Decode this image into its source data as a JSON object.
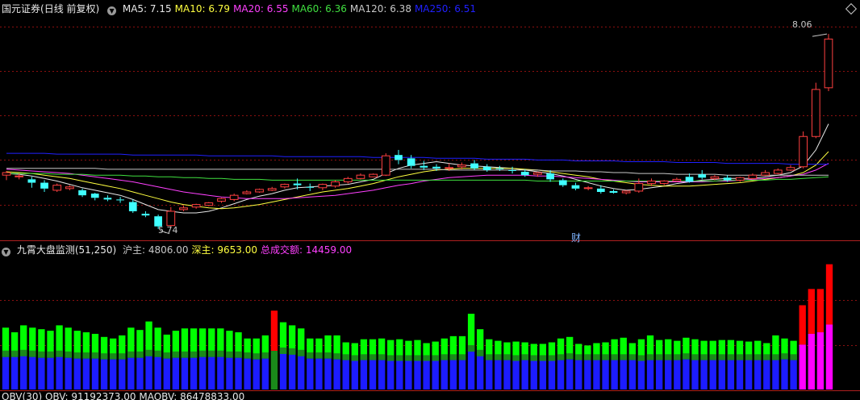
{
  "main_header": {
    "stock_name": "国元证券",
    "period_label": "(日线 前复权)",
    "toggle_icon": "chevron-down-icon",
    "ma_items": [
      {
        "label": "MA5: 7.15",
        "color": "#e8e8e8"
      },
      {
        "label": "MA10: 6.79",
        "color": "#ffff40"
      },
      {
        "label": "MA20: 6.55",
        "color": "#ff40ff"
      },
      {
        "label": "MA60: 6.36",
        "color": "#40e040"
      },
      {
        "label": "MA120: 6.38",
        "color": "#c8c8c8"
      },
      {
        "label": "MA250: 6.51",
        "color": "#2020ff"
      }
    ]
  },
  "price_labels": {
    "high": "8.06",
    "low": "5.74"
  },
  "event_marker": "财",
  "indicator_header": {
    "name": "九霄大盘监测(51,250)",
    "items": [
      {
        "label": "沪主: 4806.00",
        "color": "#c8c8c8"
      },
      {
        "label": "深主: 9653.00",
        "color": "#ffff40"
      },
      {
        "label": "总成交额: 14459.00",
        "color": "#ff40ff"
      }
    ]
  },
  "bottom_header": {
    "text": "OBV(30)  OBV: 91192373.00  MAOBV: 86478833.00"
  },
  "colors": {
    "up": "#ff4040",
    "down": "#40ffff",
    "grid": "#8b1010",
    "bar_green": "#00ff00",
    "bar_blue": "#1c1cff",
    "bar_red": "#ff0000",
    "bar_magenta": "#ff00ff",
    "bar_darkgreen": "#1a8a1a"
  },
  "chart_data": {
    "type": "candlestick",
    "candles": [
      [
        6.38,
        6.43,
        6.41,
        6.32
      ],
      [
        6.36,
        6.4,
        6.37,
        6.33
      ],
      [
        6.33,
        6.36,
        6.29,
        6.23
      ],
      [
        6.29,
        6.32,
        6.22,
        6.18
      ],
      [
        6.2,
        6.28,
        6.26,
        6.18
      ],
      [
        6.22,
        6.26,
        6.24,
        6.2
      ],
      [
        6.2,
        6.22,
        6.14,
        6.12
      ],
      [
        6.16,
        6.17,
        6.11,
        6.08
      ],
      [
        6.11,
        6.14,
        6.09,
        6.07
      ],
      [
        6.09,
        6.12,
        6.08,
        6.05
      ],
      [
        6.06,
        6.09,
        5.95,
        5.93
      ],
      [
        5.92,
        5.95,
        5.9,
        5.88
      ],
      [
        5.89,
        5.91,
        5.77,
        5.74
      ],
      [
        5.78,
        6.0,
        5.95,
        5.76
      ],
      [
        5.97,
        6.02,
        5.99,
        5.95
      ],
      [
        6.0,
        6.04,
        6.03,
        5.98
      ],
      [
        6.02,
        6.06,
        6.05,
        6.01
      ],
      [
        6.07,
        6.11,
        6.1,
        6.05
      ],
      [
        6.09,
        6.16,
        6.14,
        6.07
      ],
      [
        6.16,
        6.2,
        6.18,
        6.15
      ],
      [
        6.18,
        6.22,
        6.21,
        6.17
      ],
      [
        6.2,
        6.24,
        6.22,
        6.19
      ],
      [
        6.24,
        6.28,
        6.27,
        6.22
      ],
      [
        6.28,
        6.34,
        6.26,
        6.21
      ],
      [
        6.24,
        6.28,
        6.23,
        6.19
      ],
      [
        6.23,
        6.28,
        6.27,
        6.2
      ],
      [
        6.25,
        6.32,
        6.3,
        6.23
      ],
      [
        6.3,
        6.36,
        6.34,
        6.28
      ],
      [
        6.34,
        6.4,
        6.38,
        6.33
      ],
      [
        6.36,
        6.4,
        6.39,
        6.36
      ],
      [
        6.38,
        6.64,
        6.61,
        6.37
      ],
      [
        6.62,
        6.68,
        6.56,
        6.51
      ],
      [
        6.58,
        6.62,
        6.49,
        6.46
      ],
      [
        6.49,
        6.55,
        6.47,
        6.44
      ],
      [
        6.48,
        6.51,
        6.46,
        6.43
      ],
      [
        6.46,
        6.52,
        6.47,
        6.43
      ],
      [
        6.48,
        6.53,
        6.5,
        6.45
      ],
      [
        6.52,
        6.56,
        6.46,
        6.44
      ],
      [
        6.48,
        6.51,
        6.44,
        6.42
      ],
      [
        6.46,
        6.49,
        6.45,
        6.43
      ],
      [
        6.44,
        6.48,
        6.43,
        6.4
      ],
      [
        6.42,
        6.45,
        6.38,
        6.36
      ],
      [
        6.39,
        6.42,
        6.41,
        6.36
      ],
      [
        6.4,
        6.44,
        6.33,
        6.3
      ],
      [
        6.32,
        6.34,
        6.26,
        6.24
      ],
      [
        6.26,
        6.29,
        6.22,
        6.2
      ],
      [
        6.22,
        6.25,
        6.23,
        6.2
      ],
      [
        6.22,
        6.26,
        6.18,
        6.16
      ],
      [
        6.19,
        6.21,
        6.17,
        6.16
      ],
      [
        6.17,
        6.2,
        6.19,
        6.15
      ],
      [
        6.19,
        6.34,
        6.28,
        6.17
      ],
      [
        6.28,
        6.34,
        6.31,
        6.25
      ],
      [
        6.28,
        6.32,
        6.31,
        6.26
      ],
      [
        6.31,
        6.35,
        6.33,
        6.3
      ],
      [
        6.36,
        6.4,
        6.3,
        6.29
      ],
      [
        6.39,
        6.44,
        6.35,
        6.33
      ],
      [
        6.34,
        6.38,
        6.36,
        6.32
      ],
      [
        6.35,
        6.38,
        6.32,
        6.3
      ],
      [
        6.32,
        6.36,
        6.35,
        6.3
      ],
      [
        6.34,
        6.4,
        6.38,
        6.33
      ],
      [
        6.38,
        6.44,
        6.41,
        6.37
      ],
      [
        6.4,
        6.46,
        6.44,
        6.39
      ],
      [
        6.44,
        6.5,
        6.47,
        6.43
      ],
      [
        6.48,
        6.9,
        6.84,
        6.46
      ],
      [
        6.84,
        7.48,
        7.4,
        6.82
      ],
      [
        7.42,
        8.06,
        8.0,
        7.38
      ]
    ],
    "ma_series": [
      {
        "name": "MA5",
        "values": [
          6.4,
          6.39,
          6.37,
          6.34,
          6.31,
          6.27,
          6.23,
          6.2,
          6.17,
          6.14,
          6.09,
          6.03,
          5.97,
          5.95,
          5.93,
          5.93,
          5.95,
          5.99,
          6.04,
          6.09,
          6.13,
          6.16,
          6.2,
          6.23,
          6.24,
          6.25,
          6.26,
          6.27,
          6.3,
          6.33,
          6.4,
          6.46,
          6.5,
          6.52,
          6.54,
          6.52,
          6.5,
          6.49,
          6.48,
          6.47,
          6.46,
          6.44,
          6.42,
          6.4,
          6.37,
          6.33,
          6.29,
          6.25,
          6.22,
          6.2,
          6.21,
          6.23,
          6.25,
          6.28,
          6.3,
          6.32,
          6.33,
          6.34,
          6.34,
          6.34,
          6.36,
          6.38,
          6.41,
          6.49,
          6.68,
          6.99
        ]
      },
      {
        "name": "MA10",
        "values": [
          6.42,
          6.41,
          6.4,
          6.38,
          6.36,
          6.34,
          6.31,
          6.28,
          6.25,
          6.22,
          6.18,
          6.14,
          6.1,
          6.06,
          6.03,
          6.01,
          5.99,
          5.98,
          5.99,
          6.01,
          6.03,
          6.06,
          6.09,
          6.12,
          6.15,
          6.18,
          6.2,
          6.22,
          6.25,
          6.28,
          6.32,
          6.36,
          6.39,
          6.42,
          6.44,
          6.45,
          6.46,
          6.46,
          6.46,
          6.46,
          6.46,
          6.45,
          6.44,
          6.42,
          6.4,
          6.38,
          6.36,
          6.33,
          6.31,
          6.29,
          6.27,
          6.26,
          6.25,
          6.25,
          6.25,
          6.26,
          6.27,
          6.28,
          6.29,
          6.31,
          6.33,
          6.35,
          6.37,
          6.41,
          6.5,
          6.66
        ]
      },
      {
        "name": "MA20",
        "values": [
          6.45,
          6.44,
          6.43,
          6.42,
          6.41,
          6.4,
          6.38,
          6.36,
          6.34,
          6.32,
          6.3,
          6.27,
          6.24,
          6.21,
          6.18,
          6.16,
          6.14,
          6.12,
          6.11,
          6.1,
          6.1,
          6.1,
          6.1,
          6.11,
          6.12,
          6.13,
          6.14,
          6.16,
          6.18,
          6.2,
          6.23,
          6.26,
          6.28,
          6.31,
          6.33,
          6.35,
          6.36,
          6.37,
          6.38,
          6.38,
          6.38,
          6.38,
          6.37,
          6.37,
          6.36,
          6.35,
          6.34,
          6.33,
          6.32,
          6.31,
          6.3,
          6.3,
          6.3,
          6.3,
          6.3,
          6.3,
          6.31,
          6.31,
          6.32,
          6.33,
          6.34,
          6.35,
          6.37,
          6.39,
          6.44,
          6.52
        ]
      },
      {
        "name": "MA60",
        "values": [
          6.4,
          6.4,
          6.4,
          6.4,
          6.39,
          6.39,
          6.39,
          6.38,
          6.38,
          6.38,
          6.37,
          6.37,
          6.36,
          6.36,
          6.35,
          6.35,
          6.34,
          6.34,
          6.33,
          6.33,
          6.33,
          6.32,
          6.32,
          6.32,
          6.32,
          6.32,
          6.32,
          6.32,
          6.32,
          6.32,
          6.32,
          6.32,
          6.32,
          6.32,
          6.32,
          6.32,
          6.32,
          6.32,
          6.32,
          6.32,
          6.32,
          6.32,
          6.31,
          6.31,
          6.31,
          6.31,
          6.31,
          6.31,
          6.31,
          6.31,
          6.31,
          6.31,
          6.31,
          6.31,
          6.31,
          6.31,
          6.31,
          6.32,
          6.32,
          6.32,
          6.32,
          6.33,
          6.33,
          6.34,
          6.35,
          6.36
        ]
      },
      {
        "name": "MA120",
        "values": [
          6.46,
          6.46,
          6.46,
          6.46,
          6.46,
          6.46,
          6.46,
          6.46,
          6.45,
          6.45,
          6.45,
          6.45,
          6.45,
          6.45,
          6.45,
          6.45,
          6.45,
          6.45,
          6.45,
          6.45,
          6.45,
          6.45,
          6.45,
          6.45,
          6.45,
          6.45,
          6.45,
          6.45,
          6.45,
          6.45,
          6.45,
          6.45,
          6.45,
          6.45,
          6.45,
          6.44,
          6.44,
          6.44,
          6.44,
          6.44,
          6.44,
          6.44,
          6.44,
          6.43,
          6.43,
          6.43,
          6.42,
          6.42,
          6.41,
          6.41,
          6.4,
          6.4,
          6.4,
          6.39,
          6.39,
          6.39,
          6.39,
          6.38,
          6.38,
          6.38,
          6.38,
          6.38,
          6.38,
          6.38,
          6.38,
          6.38
        ]
      },
      {
        "name": "MA250",
        "values": [
          6.64,
          6.64,
          6.64,
          6.64,
          6.63,
          6.63,
          6.63,
          6.63,
          6.63,
          6.63,
          6.62,
          6.62,
          6.62,
          6.62,
          6.62,
          6.62,
          6.61,
          6.61,
          6.61,
          6.61,
          6.61,
          6.61,
          6.6,
          6.6,
          6.6,
          6.6,
          6.6,
          6.6,
          6.6,
          6.59,
          6.59,
          6.59,
          6.59,
          6.59,
          6.58,
          6.58,
          6.58,
          6.58,
          6.57,
          6.57,
          6.57,
          6.57,
          6.56,
          6.56,
          6.56,
          6.55,
          6.55,
          6.55,
          6.55,
          6.54,
          6.54,
          6.54,
          6.54,
          6.53,
          6.53,
          6.53,
          6.53,
          6.52,
          6.52,
          6.52,
          6.52,
          6.52,
          6.51,
          6.51,
          6.51,
          6.51
        ]
      }
    ],
    "indicator_bars": [
      [
        8000,
        4200,
        0
      ],
      [
        7400,
        4200,
        0
      ],
      [
        8300,
        4300,
        0
      ],
      [
        8000,
        4200,
        0
      ],
      [
        7800,
        4100,
        0
      ],
      [
        7600,
        4100,
        0
      ],
      [
        8300,
        4200,
        0
      ],
      [
        8000,
        4100,
        0
      ],
      [
        7600,
        4000,
        0
      ],
      [
        7400,
        4000,
        0
      ],
      [
        7200,
        4000,
        0
      ],
      [
        6800,
        3900,
        0
      ],
      [
        6600,
        3900,
        0
      ],
      [
        7000,
        3900,
        0
      ],
      [
        8000,
        4100,
        0
      ],
      [
        7700,
        4100,
        0
      ],
      [
        8800,
        4300,
        0
      ],
      [
        8000,
        4200,
        0
      ],
      [
        7100,
        4000,
        0
      ],
      [
        7600,
        4100,
        0
      ],
      [
        7900,
        4100,
        0
      ],
      [
        7900,
        4100,
        0
      ],
      [
        7900,
        4200,
        0
      ],
      [
        7900,
        4200,
        0
      ],
      [
        7900,
        4200,
        0
      ],
      [
        7600,
        4100,
        0
      ],
      [
        7400,
        4100,
        0
      ],
      [
        6600,
        4000,
        0
      ],
      [
        6600,
        3900,
        0
      ],
      [
        7000,
        4000,
        0
      ],
      [
        10200,
        5000,
        4000
      ],
      [
        8700,
        4600,
        0
      ],
      [
        8300,
        4500,
        0
      ],
      [
        7900,
        4300,
        0
      ],
      [
        6600,
        4000,
        0
      ],
      [
        6600,
        4000,
        0
      ],
      [
        7000,
        4000,
        0
      ],
      [
        7000,
        3900,
        0
      ],
      [
        6100,
        3800,
        0
      ],
      [
        6000,
        3700,
        0
      ],
      [
        6500,
        3800,
        0
      ],
      [
        6500,
        3800,
        0
      ],
      [
        6600,
        3800,
        0
      ],
      [
        6400,
        3700,
        0
      ],
      [
        6500,
        3700,
        0
      ],
      [
        6300,
        3700,
        0
      ],
      [
        6400,
        3700,
        0
      ],
      [
        6000,
        3700,
        0
      ],
      [
        6200,
        3700,
        0
      ],
      [
        6600,
        3800,
        0
      ],
      [
        6900,
        3800,
        0
      ],
      [
        6900,
        3800,
        0
      ],
      [
        9800,
        4900,
        0
      ],
      [
        7800,
        4300,
        0
      ],
      [
        6500,
        3800,
        0
      ],
      [
        6300,
        3800,
        0
      ],
      [
        6100,
        3800,
        0
      ],
      [
        6200,
        3700,
        0
      ],
      [
        6100,
        3800,
        0
      ],
      [
        5900,
        3700,
        0
      ],
      [
        5900,
        3700,
        0
      ],
      [
        6100,
        3700,
        0
      ],
      [
        6600,
        3800,
        0
      ],
      [
        6800,
        3900,
        0
      ],
      [
        5900,
        3800,
        0
      ],
      [
        5700,
        3800,
        0
      ],
      [
        6000,
        3800,
        0
      ],
      [
        6100,
        3800,
        0
      ],
      [
        6500,
        3800,
        0
      ],
      [
        6700,
        3800,
        0
      ],
      [
        6000,
        3800,
        0
      ],
      [
        6500,
        3700,
        0
      ],
      [
        7000,
        3800,
        0
      ],
      [
        6400,
        3800,
        0
      ],
      [
        6500,
        3800,
        0
      ],
      [
        6300,
        3800,
        0
      ],
      [
        6700,
        3900,
        0
      ],
      [
        6500,
        3800,
        0
      ],
      [
        6300,
        3800,
        0
      ],
      [
        6300,
        3800,
        0
      ],
      [
        6400,
        3800,
        0
      ],
      [
        6400,
        3800,
        0
      ],
      [
        6300,
        3800,
        0
      ],
      [
        6200,
        3800,
        0
      ],
      [
        6300,
        3800,
        0
      ],
      [
        6000,
        3800,
        0
      ],
      [
        7000,
        3800,
        0
      ],
      [
        6600,
        3900,
        0
      ],
      [
        6300,
        3800,
        0
      ],
      [
        10900,
        5800,
        0
      ],
      [
        13000,
        7200,
        0
      ],
      [
        13000,
        7400,
        0
      ],
      [
        16200,
        8400,
        0
      ]
    ],
    "indicator_ymax": 17000
  }
}
